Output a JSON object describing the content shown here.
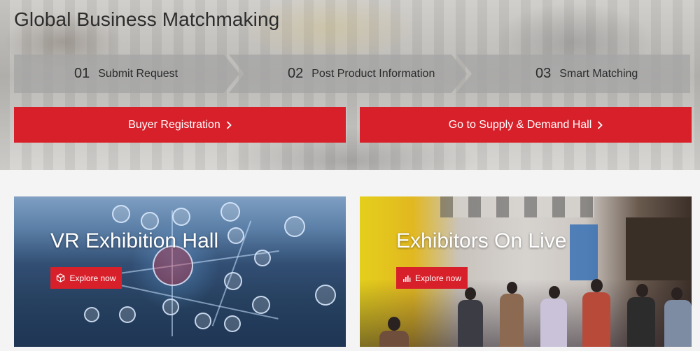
{
  "hero": {
    "title": "Global Business Matchmaking",
    "steps": [
      {
        "number": "01",
        "label": "Submit Request"
      },
      {
        "number": "02",
        "label": "Post Product Information"
      },
      {
        "number": "03",
        "label": "Smart Matching"
      }
    ],
    "buyer_button": "Buyer Registration",
    "hall_button": "Go to Supply & Demand Hall",
    "chevron_icon": "chevron-right-icon"
  },
  "cards": {
    "vr": {
      "title": "VR Exhibition Hall",
      "button": "Explore now",
      "icon": "cube-icon"
    },
    "live": {
      "title": "Exhibitors On Live",
      "button": "Explore now",
      "icon": "bar-chart-icon"
    }
  },
  "colors": {
    "accent": "#d8202a",
    "step_bg": "#a5a5a5",
    "text_dark": "#2d2d2d"
  }
}
